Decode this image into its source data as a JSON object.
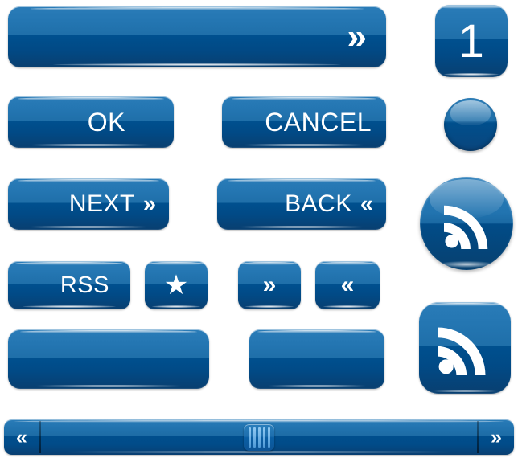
{
  "theme": {
    "accent_top": "#2a7cb8",
    "accent_mid": "#1f6fa9",
    "accent_dark": "#004f8e",
    "accent_bottom": "#093f70",
    "text_color": "#ffffff",
    "background": "#ffffff"
  },
  "buttons": {
    "wide_forward": {
      "label": "",
      "icon": "double-chevron-right-icon",
      "glyph": "»"
    },
    "ok": {
      "label": "OK"
    },
    "cancel": {
      "label": "CANCEL"
    },
    "next": {
      "label": "NEXT",
      "icon": "double-chevron-right-icon",
      "glyph": "»"
    },
    "back": {
      "label": "BACK",
      "icon": "double-chevron-left-icon",
      "glyph": "«"
    },
    "rss_label": {
      "label": "RSS"
    },
    "star": {
      "label": "",
      "icon": "star-icon",
      "glyph": "★"
    },
    "forward_small": {
      "label": "",
      "icon": "double-chevron-right-icon",
      "glyph": "»"
    },
    "back_small": {
      "label": "",
      "icon": "double-chevron-left-icon",
      "glyph": "«"
    },
    "blank_wide": {
      "label": ""
    },
    "blank_small": {
      "label": ""
    },
    "number_tile": {
      "label": "1"
    },
    "sphere": {
      "label": "",
      "icon": "sphere-icon"
    },
    "rss_circle": {
      "label": "",
      "icon": "rss-feed-icon"
    },
    "rss_square": {
      "label": "",
      "icon": "rss-feed-icon"
    }
  },
  "scrollbar": {
    "left_arrow": {
      "glyph": "«",
      "icon": "double-chevron-left-icon"
    },
    "right_arrow": {
      "glyph": "»",
      "icon": "double-chevron-right-icon"
    },
    "thumb_grip_lines": 5,
    "thumb_position_percent": 50
  }
}
